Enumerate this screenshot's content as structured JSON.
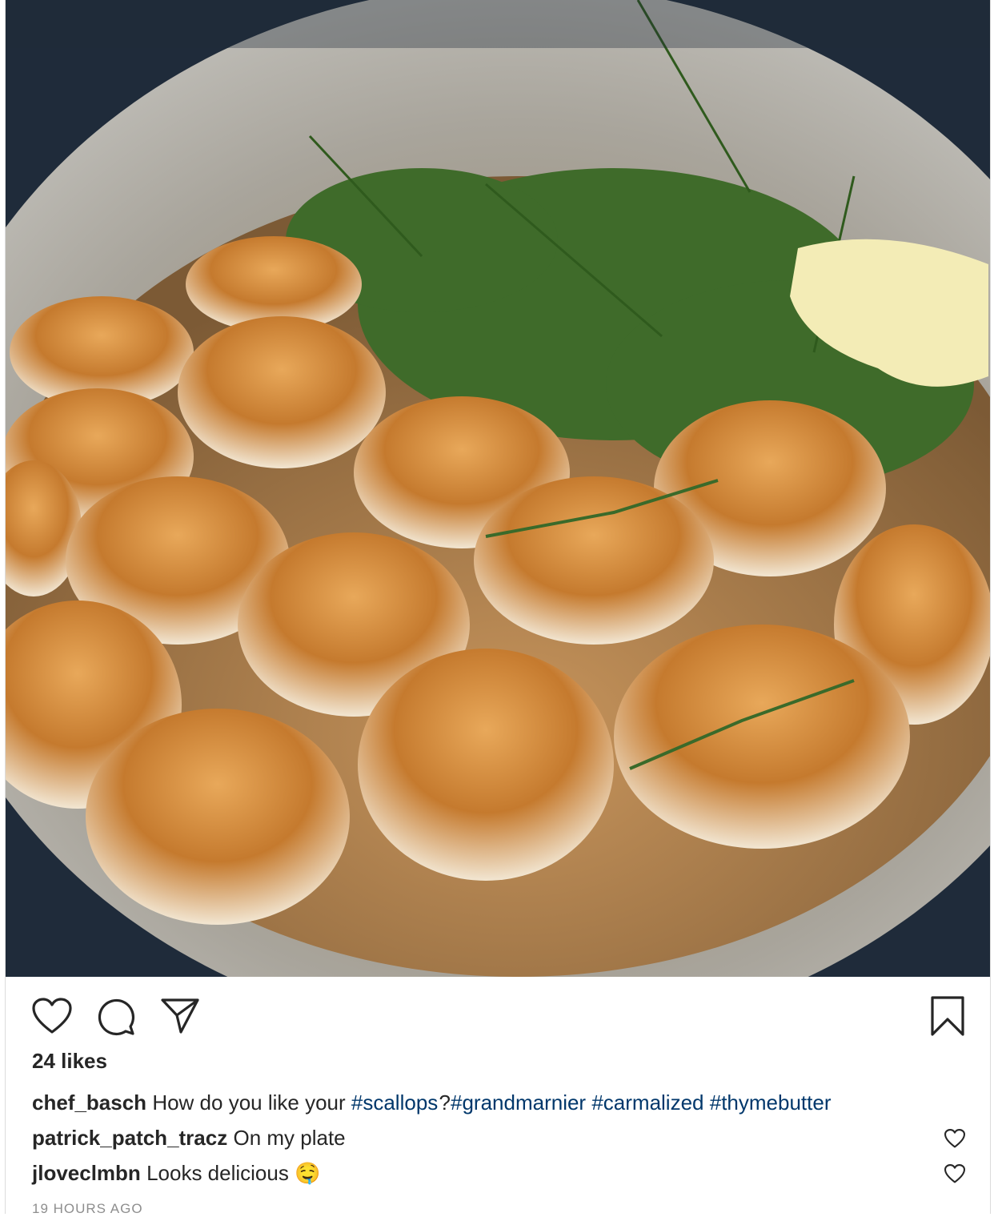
{
  "post": {
    "image_alt": "Seared scallops with thyme and butter in a pan",
    "likes": "24 likes",
    "caption": {
      "user": "chef_basch",
      "text_before": "How do you like your",
      "tag1": "#scallops",
      "text_mid": "?",
      "tag2": "#grandmarnier",
      "tag3": "#carmalized",
      "tag4": "#thymebutter"
    },
    "comments": [
      {
        "user": "patrick_patch_tracz",
        "text": "On my plate",
        "emoji": ""
      },
      {
        "user": "jloveclmbn",
        "text": "Looks delicious",
        "emoji": "🤤"
      }
    ],
    "timestamp": "19 HOURS AGO"
  },
  "icons": {
    "like": "heart-icon",
    "comment": "comment-bubble-icon",
    "share": "paper-plane-icon",
    "save": "bookmark-icon",
    "comment_like": "heart-icon"
  },
  "colors": {
    "hashtag": "#00376b",
    "text": "#262626",
    "muted": "#8e8e8e"
  }
}
